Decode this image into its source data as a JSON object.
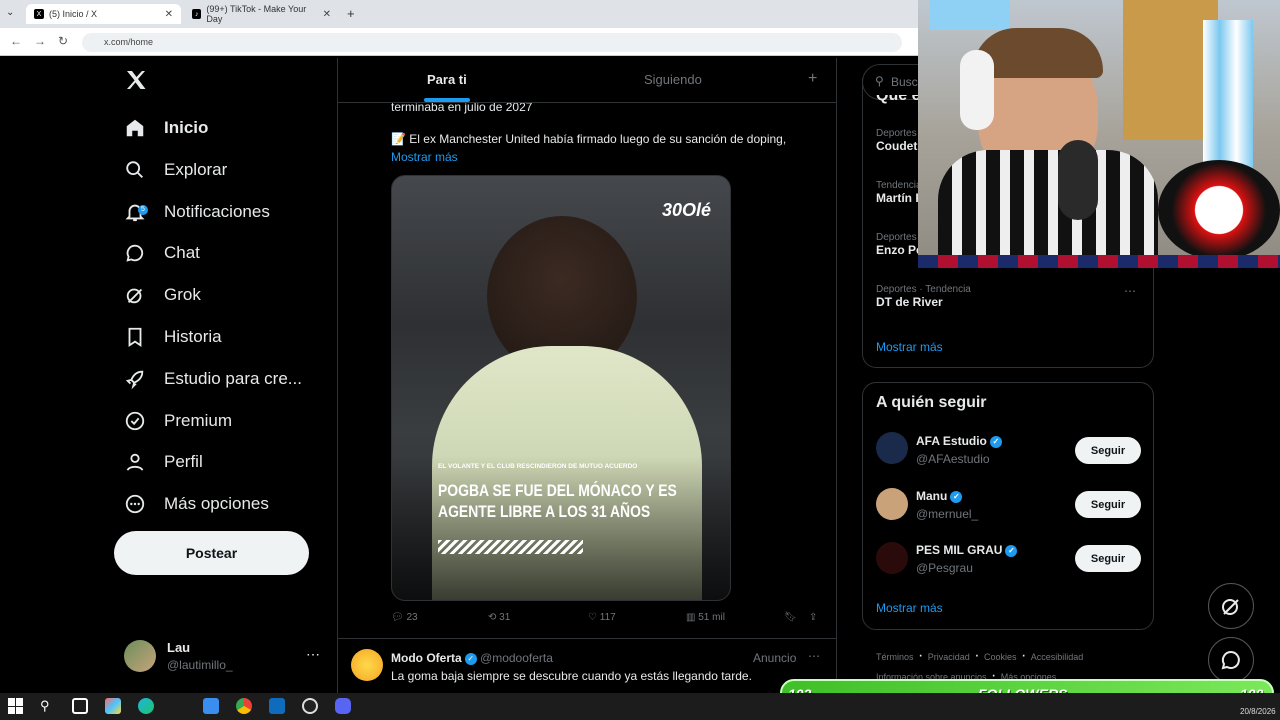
{
  "browser": {
    "tabs": [
      {
        "title": "(5) Inicio / X",
        "active": true
      },
      {
        "title": "(99+) TikTok - Make Your Day",
        "active": false
      }
    ],
    "url": "x.com/home"
  },
  "nav": {
    "items": [
      {
        "label": "Inicio",
        "icon": "home-icon"
      },
      {
        "label": "Explorar",
        "icon": "search-icon"
      },
      {
        "label": "Notificaciones",
        "icon": "bell-icon",
        "badge": "5"
      },
      {
        "label": "Chat",
        "icon": "chat-icon"
      },
      {
        "label": "Grok",
        "icon": "grok-icon"
      },
      {
        "label": "Historia",
        "icon": "bookmark-icon"
      },
      {
        "label": "Estudio para cre...",
        "icon": "rocket-icon"
      },
      {
        "label": "Premium",
        "icon": "verified-icon"
      },
      {
        "label": "Perfil",
        "icon": "person-icon"
      },
      {
        "label": "Más opciones",
        "icon": "more-circle-icon"
      }
    ],
    "post_label": "Postear",
    "user": {
      "name": "Lau",
      "handle": "@lautimillo_"
    }
  },
  "feed": {
    "tabs": [
      {
        "label": "Para ti"
      },
      {
        "label": "Siguiendo"
      }
    ],
    "tweet": {
      "text_top": "terminaba en julio de 2027",
      "text_line": "📝 El ex Manchester United había firmado luego de su sanción de doping,",
      "show_more": "Mostrar más",
      "image": {
        "brand": "Olé",
        "kicker": "EL VOLANTE Y EL CLUB RESCINDIERON DE MUTUO ACUERDO",
        "headline_1": "POGBA SE FUE DEL MÓNACO Y ES",
        "headline_2": "AGENTE LIBRE A LOS 31 AÑOS"
      },
      "replies": "23",
      "reposts": "31",
      "likes": "117",
      "views": "51 mil"
    },
    "ad": {
      "name": "Modo Oferta",
      "handle": "@modooferta",
      "label": "Anuncio",
      "text": "La goma baja siempre se descubre cuando ya estás llegando tarde."
    }
  },
  "sidebar": {
    "search_placeholder": "Busca",
    "trends_title": "Qué está pasando",
    "trends": [
      {
        "category": "Deportes",
        "name": "Coudet"
      },
      {
        "category": "Tendencia",
        "name": "Martín P"
      },
      {
        "category": "Deportes",
        "name": "Enzo Pé"
      },
      {
        "category": "Deportes · Tendencia",
        "name": "DT de River"
      }
    ],
    "trends_more": "Mostrar más",
    "follow_title": "A quién seguir",
    "follow": [
      {
        "name": "AFA Estudio",
        "handle": "@AFAestudio",
        "button": "Seguir",
        "color": "#1a2a4a"
      },
      {
        "name": "Manu",
        "handle": "@mernuel_",
        "button": "Seguir",
        "color": "#c9a27a"
      },
      {
        "name": "PES MIL GRAU",
        "handle": "@Pesgrau",
        "button": "Seguir",
        "color": "#2a0a0a"
      }
    ],
    "follow_more": "Mostrar más",
    "footer": [
      "Términos",
      "Privacidad",
      "Cookies",
      "Accesibilidad",
      "Información sobre anuncios",
      "Más opciones ..."
    ]
  },
  "overlay": {
    "followers_label": "FOLLOWERS",
    "count_left": "102",
    "count_right": "100",
    "date": "20/8/2026"
  },
  "colors": {
    "accent": "#1d9bf0",
    "bg": "#000000",
    "border": "#2f3336",
    "muted": "#71767b"
  }
}
